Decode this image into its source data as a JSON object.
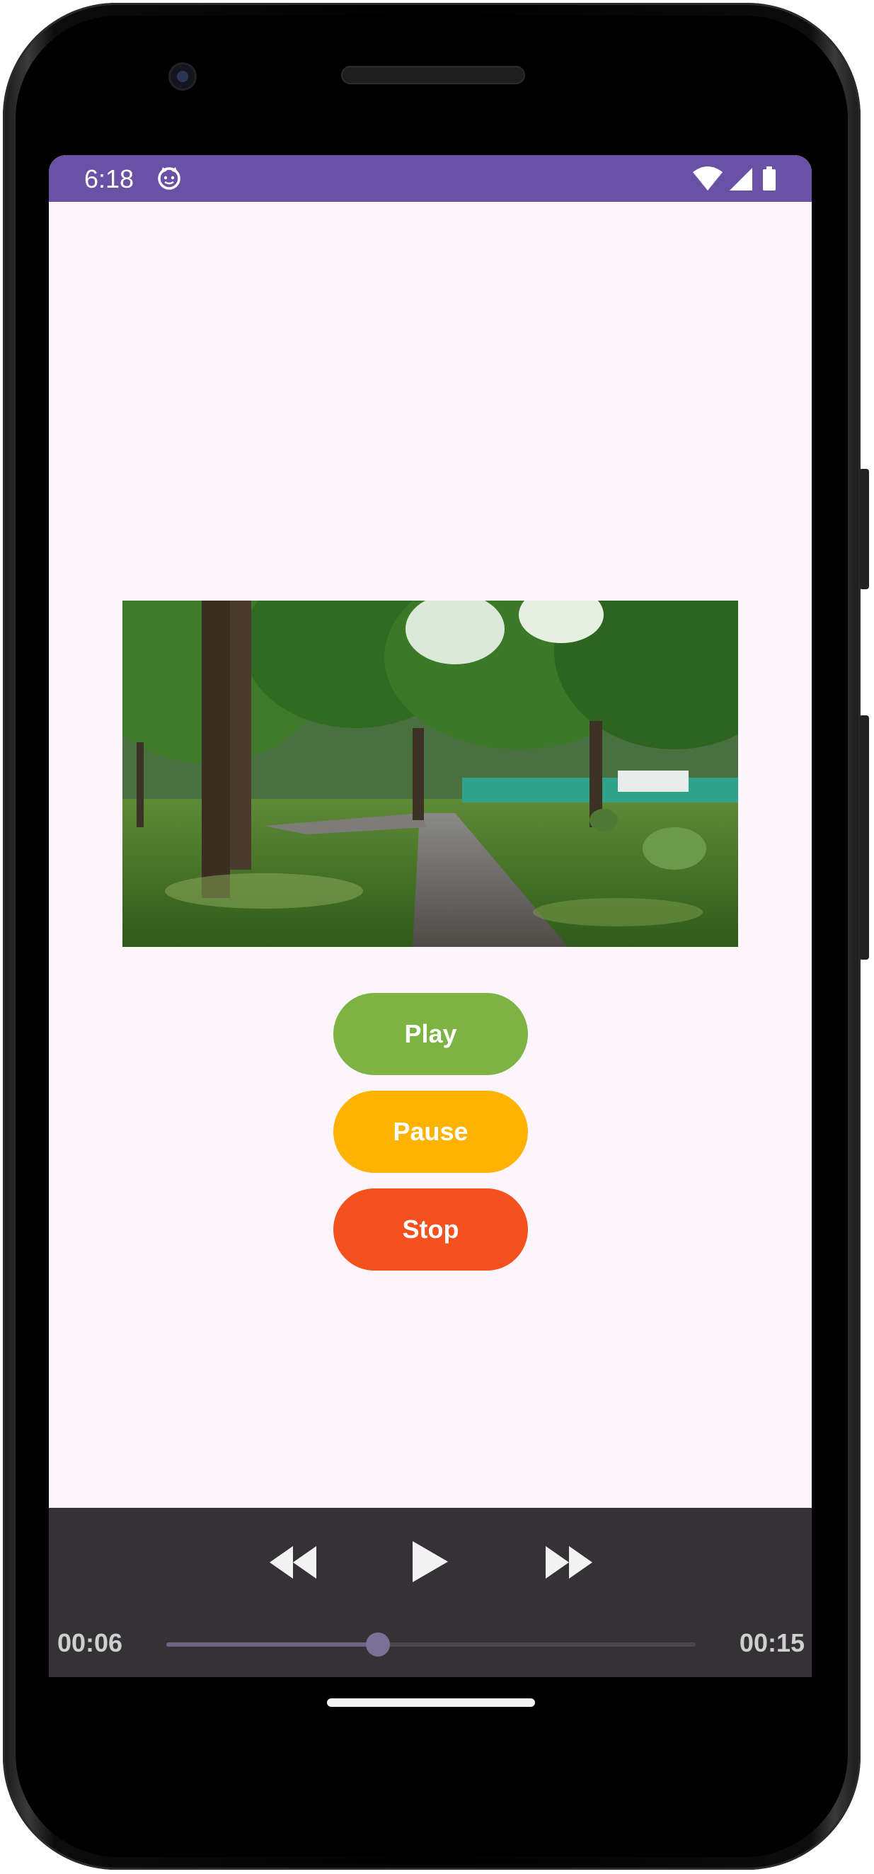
{
  "status_bar": {
    "time": "6:18",
    "color": "#6a51a6",
    "icons": [
      "cat-face-icon",
      "wifi-icon",
      "cellular-signal-icon",
      "battery-icon"
    ]
  },
  "screen": {
    "background": "#fcf5fb"
  },
  "video": {
    "scene": "park-path-with-trees-thumbnail"
  },
  "buttons": {
    "play": {
      "label": "Play",
      "color": "#7cb342"
    },
    "pause": {
      "label": "Pause",
      "color": "#ffb300"
    },
    "stop": {
      "label": "Stop",
      "color": "#f4511e"
    }
  },
  "media_controls": {
    "current_time": "00:06",
    "duration": "00:15",
    "progress_fraction": 0.4,
    "icons": [
      "rewind-icon",
      "play-icon",
      "fast-forward-icon"
    ],
    "background": "#343235"
  }
}
